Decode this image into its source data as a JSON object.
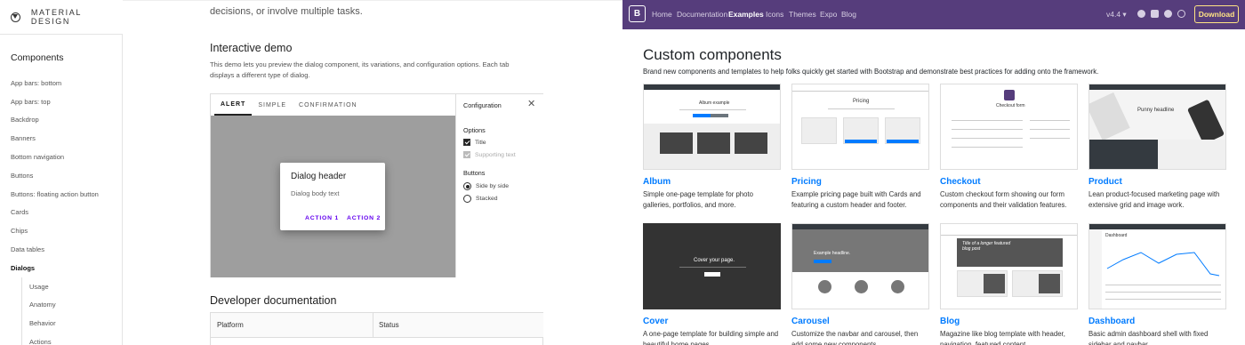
{
  "material": {
    "brand": "MATERIAL DESIGN",
    "sidebar": {
      "heading": "Components",
      "items": [
        {
          "label": "App bars: bottom"
        },
        {
          "label": "App bars: top"
        },
        {
          "label": "Backdrop"
        },
        {
          "label": "Banners"
        },
        {
          "label": "Bottom navigation"
        },
        {
          "label": "Buttons"
        },
        {
          "label": "Buttons: floating action button"
        },
        {
          "label": "Cards"
        },
        {
          "label": "Chips"
        },
        {
          "label": "Data tables"
        },
        {
          "label": "Dialogs",
          "active": true
        }
      ],
      "sub_items": [
        {
          "label": "Usage"
        },
        {
          "label": "Anatomy"
        },
        {
          "label": "Behavior"
        },
        {
          "label": "Actions"
        }
      ]
    },
    "continued_text": "decisions, or involve multiple tasks.",
    "demo_heading": "Interactive demo",
    "demo_desc": "This demo lets you preview the dialog component, its variations, and configuration options. Each tab displays a different type of dialog.",
    "tabs": [
      {
        "label": "ALERT",
        "active": true
      },
      {
        "label": "SIMPLE"
      },
      {
        "label": "CONFIRMATION"
      }
    ],
    "dialog": {
      "header": "Dialog header",
      "body": "Dialog body text",
      "action1": "ACTION 1",
      "action2": "ACTION 2"
    },
    "config": {
      "title": "Configuration",
      "close_icon": "close-icon",
      "options_label": "Options",
      "opt_title": "Title",
      "opt_supporting": "Supporting text",
      "buttons_label": "Buttons",
      "btn_side": "Side by side",
      "btn_stacked": "Stacked"
    },
    "dev_heading": "Developer documentation",
    "table_headers": [
      "Platform",
      "Status"
    ]
  },
  "bootstrap": {
    "logo": "B",
    "nav": [
      {
        "label": "Home"
      },
      {
        "label": "Documentation"
      },
      {
        "label": "Examples",
        "active": true
      },
      {
        "label": "Icons"
      },
      {
        "label": "Themes"
      },
      {
        "label": "Expo"
      },
      {
        "label": "Blog"
      }
    ],
    "version": "v4.4 ▾",
    "download": "Download",
    "heading": "Custom components",
    "lead": "Brand new components and templates to help folks quickly get started with Bootstrap and demonstrate best practices for adding onto the framework.",
    "cards": [
      {
        "title": "Album",
        "desc": "Simple one-page template for photo galleries, portfolios, and more.",
        "thumb_text": "Album example"
      },
      {
        "title": "Pricing",
        "desc": "Example pricing page built with Cards and featuring a custom header and footer.",
        "thumb_text": "Pricing"
      },
      {
        "title": "Checkout",
        "desc": "Custom checkout form showing our form components and their validation features.",
        "thumb_text": "Checkout form"
      },
      {
        "title": "Product",
        "desc": "Lean product-focused marketing page with extensive grid and image work.",
        "thumb_text": "Punny headline"
      },
      {
        "title": "Cover",
        "desc": "A one-page template for building simple and beautiful home pages.",
        "thumb_text": "Cover your page."
      },
      {
        "title": "Carousel",
        "desc": "Customize the navbar and carousel, then add some new components.",
        "thumb_text": "Example headline."
      },
      {
        "title": "Blog",
        "desc": "Magazine like blog template with header, navigation, featured content.",
        "thumb_text": "Title of a longer featured blog post"
      },
      {
        "title": "Dashboard",
        "desc": "Basic admin dashboard shell with fixed sidebar and navbar.",
        "thumb_text": "Dashboard"
      }
    ]
  }
}
